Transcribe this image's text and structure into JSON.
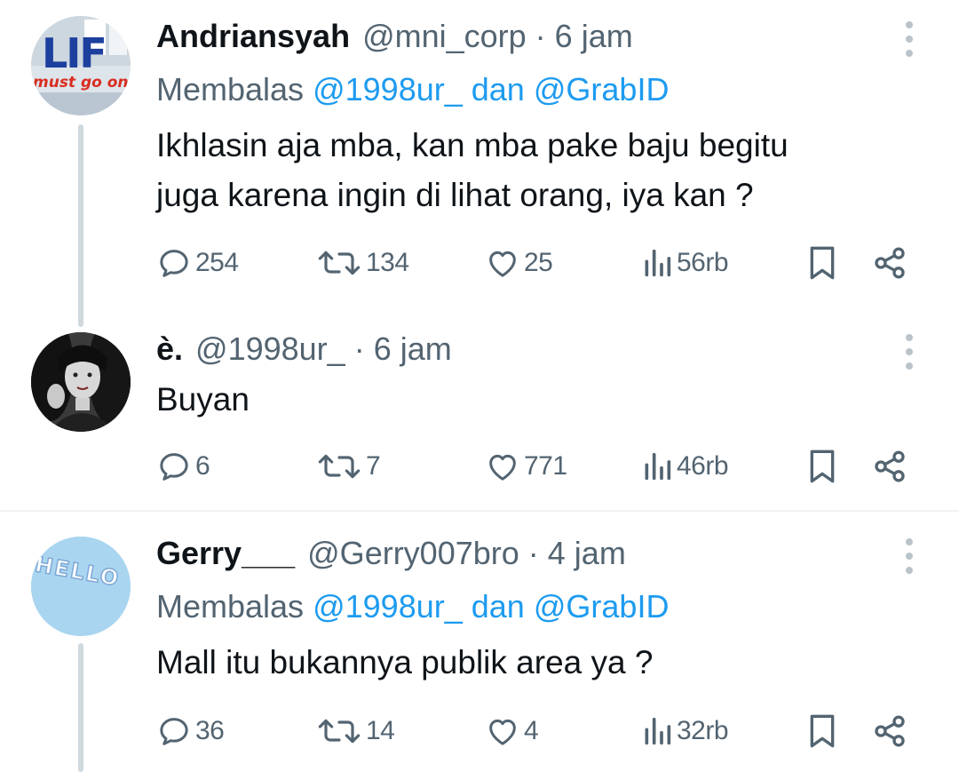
{
  "tweets": [
    {
      "name": "Andriansyah",
      "handle": "@mni_corp",
      "separator": "·",
      "time": "6 jam",
      "reply_prefix": "Membalas",
      "reply_to_1": "@1998ur_",
      "reply_joiner": "dan",
      "reply_to_2": "@GrabID",
      "text_lines": [
        "Ikhlasin aja mba, kan mba pake baju begitu",
        "juga karena ingin di lihat orang, iya kan ?"
      ],
      "replies": "254",
      "retweets": "134",
      "likes": "25",
      "views": "56rb",
      "avatar_text_1": "LIF",
      "avatar_text_2": "must go on!"
    },
    {
      "name": "è.",
      "handle": "@1998ur_",
      "separator": "·",
      "time": "6 jam",
      "text_lines": [
        "Buyan"
      ],
      "replies": "6",
      "retweets": "7",
      "likes": "771",
      "views": "46rb"
    },
    {
      "name": "Gerry___",
      "handle": "@Gerry007bro",
      "separator": "·",
      "time": "4 jam",
      "reply_prefix": "Membalas",
      "reply_to_1": "@1998ur_",
      "reply_joiner": "dan",
      "reply_to_2": "@GrabID",
      "text_lines": [
        "Mall itu bukannya publik area ya ?"
      ],
      "replies": "36",
      "retweets": "14",
      "likes": "4",
      "views": "32rb",
      "avatar_text": "HELLO"
    }
  ],
  "colors": {
    "text": "#0f1419",
    "secondary": "#536471",
    "accent": "#1d9bf0",
    "thread_line": "#cfd9de"
  },
  "icons": [
    "reply-icon",
    "retweet-icon",
    "like-icon",
    "views-icon",
    "bookmark-icon",
    "share-icon",
    "more-icon"
  ]
}
